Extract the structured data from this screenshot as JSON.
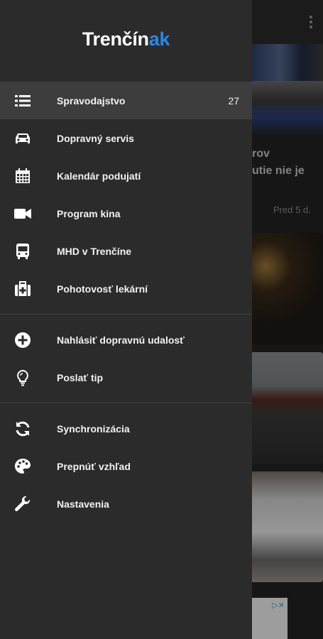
{
  "app": {
    "logo_main": "Trenčín",
    "logo_accent": "ak"
  },
  "drawer": {
    "section_main": [
      {
        "label": "Spravodajstvo",
        "count": "27",
        "icon": "list-icon",
        "active": true
      },
      {
        "label": "Dopravný servis",
        "icon": "car-icon"
      },
      {
        "label": "Kalendár podujatí",
        "icon": "calendar-icon"
      },
      {
        "label": "Program kina",
        "icon": "video-camera-icon"
      },
      {
        "label": "MHD v Trenčíne",
        "icon": "bus-icon"
      },
      {
        "label": "Pohotovosť lekární",
        "icon": "first-aid-kit-icon"
      }
    ],
    "section_actions": [
      {
        "label": "Nahlásiť dopravnú udalosť",
        "icon": "plus-circle-icon"
      },
      {
        "label": "Poslať tip",
        "icon": "lightbulb-icon"
      }
    ],
    "section_settings": [
      {
        "label": "Synchronizácia",
        "icon": "sync-icon"
      },
      {
        "label": "Prepnúť vzhľad",
        "icon": "palette-icon"
      },
      {
        "label": "Nastavenia",
        "icon": "wrench-icon"
      }
    ]
  },
  "background": {
    "card_text_line1": "rov",
    "card_text_line2": "utie nie je",
    "card_date": "Pred 5 d."
  },
  "colors": {
    "accent": "#2c86e5",
    "drawer_bg": "#2b2b2b",
    "active_bg": "#3d3d3d"
  }
}
